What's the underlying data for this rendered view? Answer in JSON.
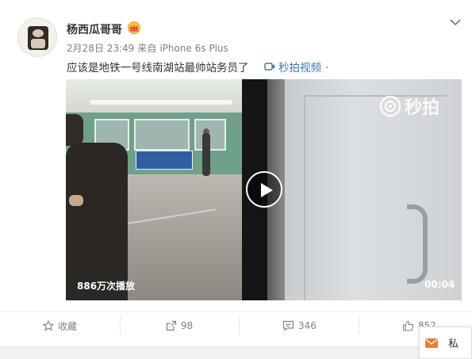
{
  "post": {
    "username": "杨西瓜哥哥",
    "date": "2月28日 23:49",
    "source_prefix": "来自",
    "source_device": "iPhone 6s Plus",
    "text": "应该是地铁一号线南湖站最帅站务员了",
    "video_link_label": "秒拍视频",
    "video_link_suffix": "."
  },
  "video": {
    "watermark": "秒拍",
    "plays": "886万次播放",
    "duration": "00:04"
  },
  "actions": {
    "favorite_label": "收藏",
    "repost_count": "98",
    "comment_count": "346",
    "like_count": "852"
  },
  "dm_widget": {
    "label": "私"
  },
  "colors": {
    "link": "#3a76b8",
    "text": "#333333",
    "meta": "#808080",
    "vip_badge": "#e8a42a",
    "mail_icon": "#f07a3a"
  },
  "icons": {
    "vip": "vip-crown-icon",
    "chevron": "chevron-down-icon",
    "video_link": "video-camera-icon",
    "watermark": "camera-lens-icon",
    "play": "play-icon",
    "favorite": "star-icon",
    "repost": "repost-icon",
    "comment": "comment-icon",
    "like": "thumbs-up-icon",
    "mail": "mail-icon"
  }
}
